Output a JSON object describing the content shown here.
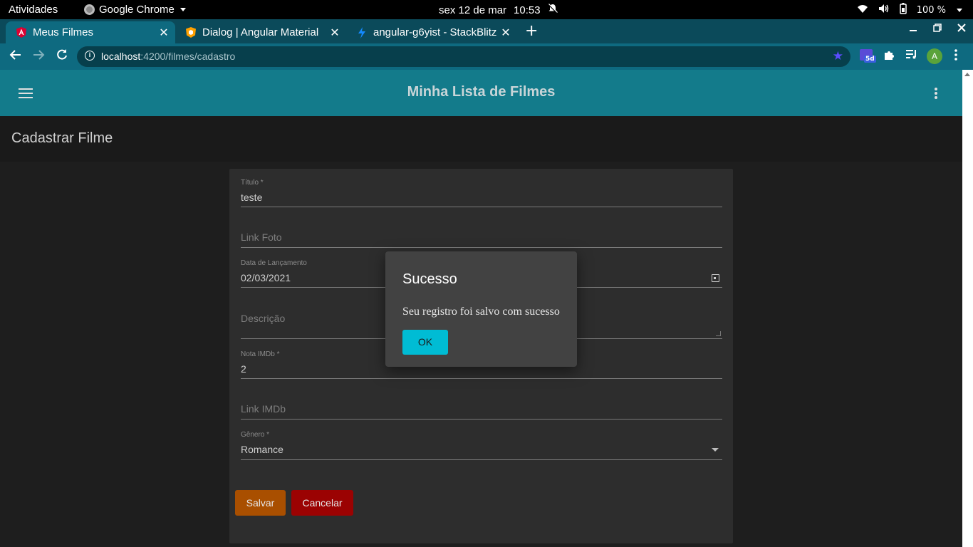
{
  "os_bar": {
    "activities": "Atividades",
    "app_name": "Google Chrome",
    "clock_date": "sex 12 de mar",
    "clock_time": "10:53",
    "battery": "100 %"
  },
  "tabs": [
    {
      "title": "Meus Filmes",
      "active": true,
      "favicon": "angular-icon"
    },
    {
      "title": "Dialog | Angular Material",
      "active": false,
      "favicon": "angular-material-icon"
    },
    {
      "title": "angular-g6yist - StackBlitz",
      "active": false,
      "favicon": "stackblitz-icon"
    }
  ],
  "omnibox": {
    "host": "localhost",
    "path": ":4200/filmes/cadastro"
  },
  "extensions": {
    "badge": "5d",
    "avatar": "A"
  },
  "app": {
    "title": "Minha Lista de Filmes",
    "page_heading": "Cadastrar Filme"
  },
  "form": {
    "titulo": {
      "label": "Título *",
      "value": "teste"
    },
    "link_foto": {
      "placeholder": "Link Foto"
    },
    "data_lancamento": {
      "label": "Data de Lançamento",
      "value": "02/03/2021"
    },
    "descricao": {
      "placeholder": "Descrição"
    },
    "nota_imdb": {
      "label": "Nota IMDb *",
      "value": "2"
    },
    "link_imdb": {
      "placeholder": "Link IMDb"
    },
    "genero": {
      "label": "Gênero *",
      "value": "Romance"
    },
    "save_label": "Salvar",
    "cancel_label": "Cancelar"
  },
  "dialog": {
    "title": "Sucesso",
    "message": "Seu registro foi salvo com sucesso",
    "ok_label": "OK"
  },
  "colors": {
    "toolbar": "#137b8b",
    "save_button": "#a94f00",
    "cancel_button": "#9b0202",
    "dialog_ok": "#00bcd4"
  }
}
